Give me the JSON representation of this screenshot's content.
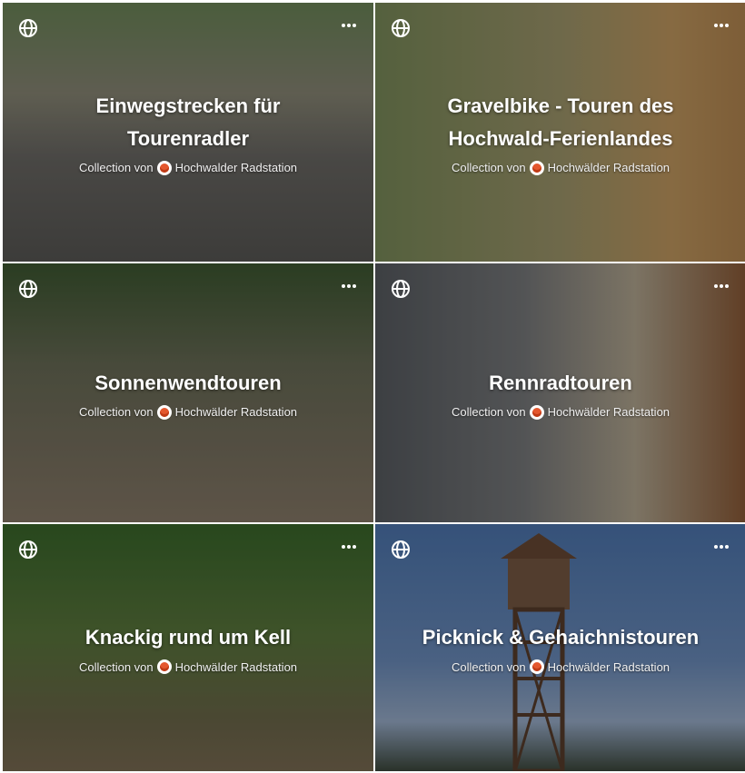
{
  "collections": [
    {
      "title_line1": "Einwegstrecken für",
      "title_line2": "Tourenradler",
      "collection_prefix": "Collection von",
      "author": "Hochwalder Radstation"
    },
    {
      "title_line1": "Gravelbike - Touren des",
      "title_line2": "Hochwald-Ferienlandes",
      "collection_prefix": "Collection von",
      "author": "Hochwälder Radstation"
    },
    {
      "title_line1": "Sonnenwendtouren",
      "title_line2": "",
      "collection_prefix": "Collection von",
      "author": "Hochwälder Radstation"
    },
    {
      "title_line1": "Rennradtouren",
      "title_line2": "",
      "collection_prefix": "Collection von",
      "author": "Hochwälder Radstation"
    },
    {
      "title_line1": "Knackig rund um Kell",
      "title_line2": "",
      "collection_prefix": "Collection von",
      "author": "Hochwälder Radstation"
    },
    {
      "title_line1": "Picknick & Gehaichnistouren",
      "title_line2": "",
      "collection_prefix": "Collection von",
      "author": "Hochwälder Radstation"
    }
  ],
  "icons": {
    "visibility": "globe-icon",
    "menu": "more-options-icon"
  },
  "colors": {
    "title": "#ffffff",
    "subtitle": "#f1f1f1",
    "avatar_accent": "#e4572e"
  }
}
